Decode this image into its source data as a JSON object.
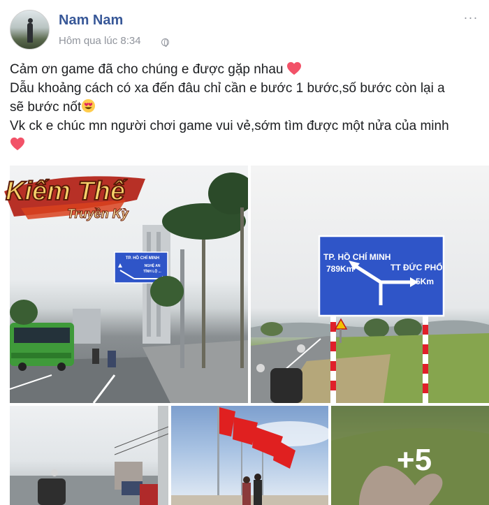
{
  "post": {
    "author": "Nam Nam",
    "timestamp": "Hôm qua lúc 8:34",
    "text_lines": [
      "Cảm ơn game đã cho chúng e được gặp nhau",
      "Dẫu khoảng cách có xa đến đâu chỉ cần e bước 1 bước,số bước còn lại a",
      "sẽ bước nốt",
      "Vk ck e chúc mn người chơi game vui vẻ,sớm tìm được một nửa của minh"
    ],
    "icons": {
      "privacy": "globe-icon",
      "options": "more-icon",
      "emoji_heart": "heart-icon",
      "emoji_grin": "grinning-heart-eyes-icon"
    }
  },
  "logo": {
    "line1": "Kiếm Thế",
    "line2": "Truyền Kỳ"
  },
  "photos": {
    "sign1": {
      "line1": "TP. HỒ CHÍ MINH",
      "line2": "NGHỆ AN",
      "line3": "TỈNH LỘ ..."
    },
    "sign2": {
      "left_title": "TP. HỒ CHÍ MINH",
      "left_distance": "789Km",
      "right_title": "TT ĐỨC PHỔ",
      "right_distance": "5Km"
    },
    "more_count": "+5"
  },
  "colors": {
    "author": "#385898",
    "meta": "#90949c",
    "heart": "#f25268",
    "sign_blue": "#2f55c8"
  }
}
